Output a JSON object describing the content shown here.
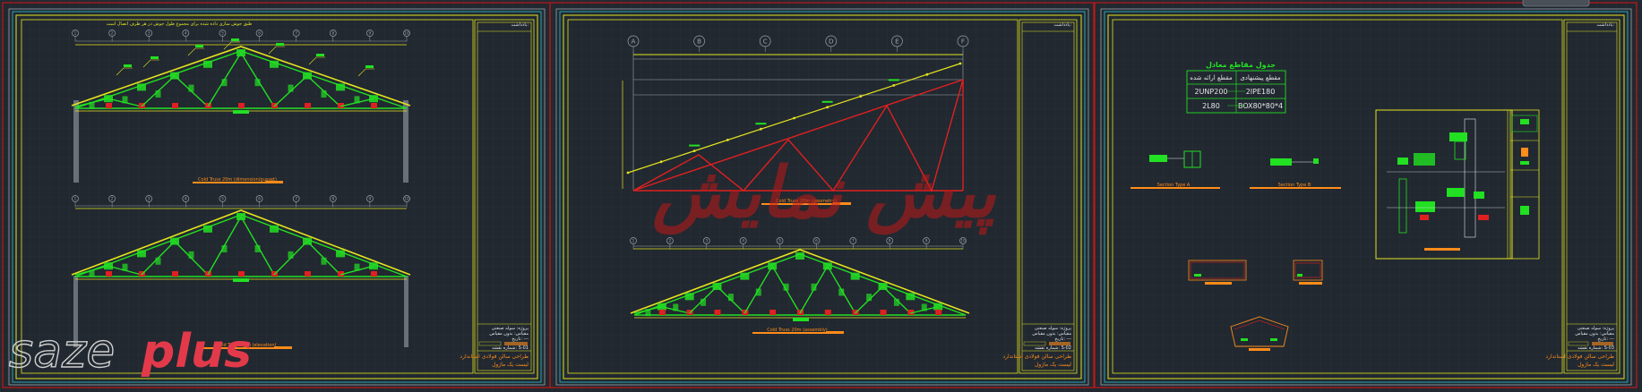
{
  "sheet1": {
    "note": "طبق جوش سازی داده شده برای مجموع طول جوش در هر طرف اتصال است",
    "caption_top": "Cold Truss 20m (dimension/gusset)",
    "caption_bottom": "Cold Truss 20m (elevation)",
    "grid_labels": [
      "1",
      "2",
      "3",
      "4",
      "5",
      "6",
      "7",
      "8",
      "9",
      "10"
    ],
    "title_block": {
      "corner": "یادداشت:",
      "project": "طراحی سالن فولادی استاندارد",
      "subtitle": "لیست یک ماژول",
      "info_lines": [
        "پروژه: سوله صنعتی",
        "مقیاس: بدون مقیاس",
        "تاریخ: ---",
        "شماره نقشه: S-01"
      ]
    }
  },
  "sheet2": {
    "caption_top": "Cold Truss 20m (geometry)",
    "caption_bottom": "Cold Truss 20m (assembly)",
    "grid_labels_top": [
      "A",
      "B",
      "C",
      "D",
      "E",
      "F"
    ],
    "grid_labels_bottom": [
      "1",
      "2",
      "3",
      "4",
      "5",
      "6",
      "7",
      "8",
      "9",
      "10"
    ],
    "title_block": {
      "corner": "یادداشت:",
      "project": "طراحی سالن فولادی استاندارد",
      "subtitle": "لیست یک ماژول",
      "info_lines": [
        "پروژه: سوله صنعتی",
        "مقیاس: بدون مقیاس",
        "تاریخ: ---",
        "شماره نقشه: S-02"
      ]
    }
  },
  "sheet3": {
    "table_title": "جدول مقاطع معادل",
    "table_headers": [
      "مقطع ارائه شده",
      "مقطع پیشنهادی"
    ],
    "table_rows": [
      [
        "2UNP200",
        "2IPE180"
      ],
      [
        "2L80",
        "BOX80*80*4"
      ]
    ],
    "section_a": "Section Type A",
    "section_b": "Section Type B",
    "title_block": {
      "corner": "یادداشت:",
      "project": "طراحی سالن فولادی استاندارد",
      "subtitle": "لیست یک ماژول",
      "info_lines": [
        "پروژه: سوله صنعتی",
        "مقیاس: بدون مقیاس",
        "تاریخ: ---",
        "شماره نقشه: S-03"
      ]
    }
  },
  "watermark": {
    "brand_left": "saze",
    "brand_right": "plus",
    "center_text": "پیش نمایش"
  },
  "colors": {
    "background": "#212830",
    "frame_red": "#c01818",
    "frame_yellow": "#e4e41e",
    "frame_cyan": "#29c4d4",
    "frame_white": "#9aa4ac",
    "member_green": "#22e022",
    "member_red": "#e02020",
    "dim_orange": "#ff8c1a",
    "text_white": "#e6e6e6",
    "watermark_red": "#e23a4a",
    "watermark_gray": "#cfcfcf"
  }
}
